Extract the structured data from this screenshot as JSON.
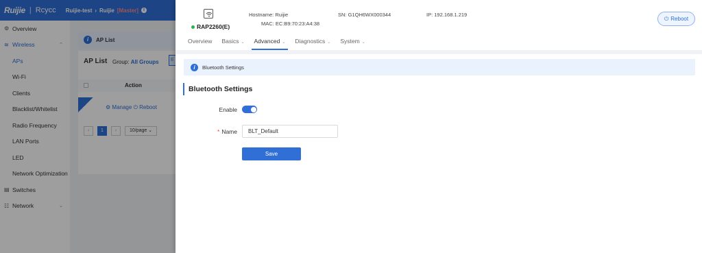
{
  "app": {
    "logo": "Ruijie",
    "logo_sub": "Rcycc",
    "breadcrumb": [
      "Ruijie-test",
      "Ruijie"
    ],
    "breadcrumb_tag": "[Master]"
  },
  "sidebar": {
    "items": [
      {
        "label": "Overview",
        "icon": "overview-icon"
      },
      {
        "label": "Wireless",
        "icon": "wifi-icon"
      },
      {
        "label": "APs"
      },
      {
        "label": "Wi-Fi"
      },
      {
        "label": "Clients"
      },
      {
        "label": "Blacklist/Whitelist"
      },
      {
        "label": "Radio Frequency"
      },
      {
        "label": "LAN Ports"
      },
      {
        "label": "LED"
      },
      {
        "label": "Network Optimization"
      },
      {
        "label": "Switches",
        "icon": "switch-icon"
      },
      {
        "label": "Network",
        "icon": "network-icon"
      }
    ]
  },
  "background": {
    "header": "AP List",
    "title": "AP List",
    "group_label": "Group:",
    "group_value": "All Groups",
    "col_action": "Action",
    "manage": "Manage",
    "reboot": "Reboot",
    "page": "1",
    "page_size": "10/page"
  },
  "device": {
    "name": "RAP2260(E)",
    "hostname_label": "Hostname:",
    "hostname": "Ruijie",
    "sn_label": "SN:",
    "sn": "G1QH6WX000344",
    "ip_label": "IP:",
    "ip": "192.168.1.219",
    "mac_label": "MAC:",
    "mac": "EC:B9:70:23:A4:38",
    "reboot": "Reboot"
  },
  "tabs": [
    {
      "label": "Overview"
    },
    {
      "label": "Basics"
    },
    {
      "label": "Advanced"
    },
    {
      "label": "Diagnostics"
    },
    {
      "label": "System"
    }
  ],
  "notice": "Bluetooth Settings",
  "section_title": "Bluetooth Settings",
  "form": {
    "enable_label": "Enable",
    "name_label": "Name",
    "name_value": "BLT_Default",
    "save": "Save"
  }
}
